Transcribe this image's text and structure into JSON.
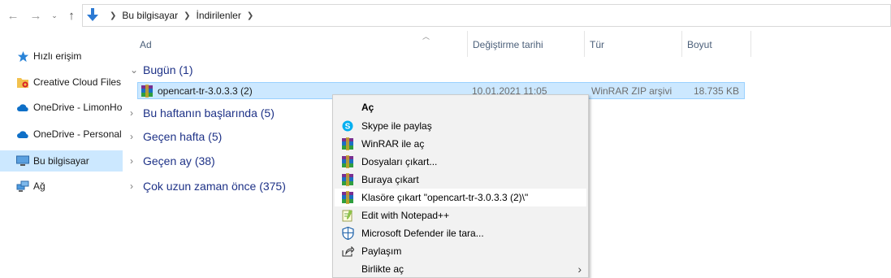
{
  "nav": {
    "back_glyph": "←",
    "forward_glyph": "→",
    "recent_glyph": "⌄",
    "up_glyph": "↑"
  },
  "breadcrumb": [
    "Bu bilgisayar",
    "İndirilenler"
  ],
  "sidebar": {
    "items": [
      {
        "label": "Hızlı erişim",
        "icon": "star-icon"
      },
      {
        "label": "Creative Cloud Files",
        "icon": "creative-cloud-folder-icon"
      },
      {
        "label": "OneDrive - LimonHo",
        "icon": "onedrive-cloud-icon"
      },
      {
        "label": "OneDrive - Personal",
        "icon": "onedrive-cloud-icon"
      },
      {
        "label": "Bu bilgisayar",
        "icon": "computer-icon"
      },
      {
        "label": "Ağ",
        "icon": "network-icon"
      }
    ]
  },
  "columns": {
    "name": "Ad",
    "modified": "Değiştirme tarihi",
    "type": "Tür",
    "size": "Boyut"
  },
  "groups": [
    {
      "label": "Bugün (1)",
      "expanded": true
    },
    {
      "label": "Bu haftanın başlarında (5)",
      "expanded": false
    },
    {
      "label": "Geçen hafta (5)",
      "expanded": false
    },
    {
      "label": "Geçen ay (38)",
      "expanded": false
    },
    {
      "label": "Çok uzun zaman önce (375)",
      "expanded": false
    }
  ],
  "file": {
    "name": "opencart-tr-3.0.3.3 (2)",
    "modified": "10.01.2021 11:05",
    "type": "WinRAR ZIP arşivi",
    "size": "18.735 KB"
  },
  "context_menu": {
    "items": [
      {
        "label": "Aç",
        "icon": "",
        "bold": true
      },
      {
        "label": "Skype ile paylaş",
        "icon": "skype-icon"
      },
      {
        "label": "WinRAR ile aç",
        "icon": "winrar-icon"
      },
      {
        "label": "Dosyaları çıkart...",
        "icon": "winrar-icon"
      },
      {
        "label": "Buraya çıkart",
        "icon": "winrar-icon"
      },
      {
        "label": "Klasöre çıkart \"opencart-tr-3.0.3.3 (2)\\\"",
        "icon": "winrar-icon",
        "hover": true
      },
      {
        "label": "Edit with Notepad++",
        "icon": "notepadpp-icon"
      },
      {
        "label": "Microsoft Defender ile tara...",
        "icon": "defender-shield-icon"
      },
      {
        "label": "Paylaşım",
        "icon": "share-icon"
      },
      {
        "label": "Birlikte aç",
        "icon": "",
        "submenu": true
      }
    ]
  },
  "colors": {
    "selection_bg": "#cce8ff",
    "selection_border": "#99d1ff",
    "group_text": "#1e3287",
    "menu_bg": "#f2f2f2"
  }
}
